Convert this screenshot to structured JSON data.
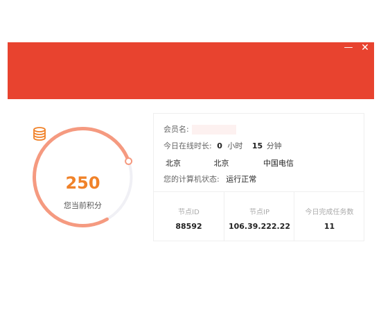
{
  "window": {
    "minimize_glyph": "—",
    "close_glyph": "✕",
    "banner_color": "#e8432f"
  },
  "score_panel": {
    "score": "250",
    "label": "您当前积分",
    "progress_fraction": 0.78,
    "ring_color": "#f59a80",
    "track_color": "#f0f0f5",
    "score_color": "#f08229",
    "icon": "coins-icon"
  },
  "info": {
    "member_name_label": "会员名:",
    "member_name_value": "",
    "online_label": "今日在线时长:",
    "hours_value": "0",
    "hours_unit": "小时",
    "minutes_value": "15",
    "minutes_unit": "分钟",
    "province": "北京",
    "city": "北京",
    "isp": "中国电信",
    "status_label": "您的计算机状态:",
    "status_value": "运行正常"
  },
  "stats": [
    {
      "title": "节点ID",
      "value": "88592"
    },
    {
      "title": "节点IP",
      "value": "106.39.222.22"
    },
    {
      "title": "今日完成任务数",
      "value": "11"
    }
  ]
}
